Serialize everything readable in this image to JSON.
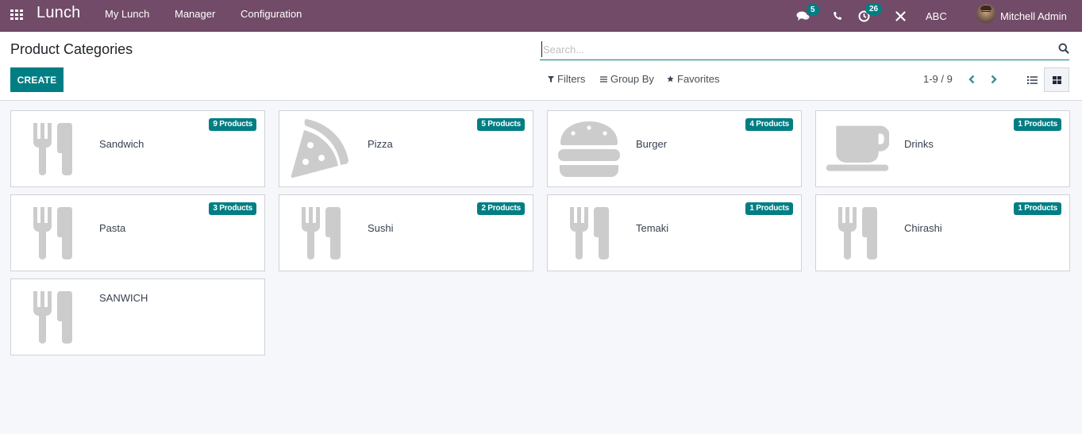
{
  "navbar": {
    "app_name": "Lunch",
    "menus": [
      "My Lunch",
      "Manager",
      "Configuration"
    ],
    "messages_count": "5",
    "activities_count": "26",
    "company": "ABC",
    "user_name": "Mitchell Admin",
    "bg_color": "#714b67",
    "badge_color": "#017e84"
  },
  "control_panel": {
    "title": "Product Categories",
    "create_label": "CREATE",
    "search_placeholder": "Search...",
    "search_value": "",
    "filters_label": "Filters",
    "group_by_label": "Group By",
    "favorites_label": "Favorites",
    "pager": "1-9 / 9",
    "active_view": "kanban"
  },
  "categories": [
    {
      "name": "Sandwich",
      "badge": "9 Products",
      "icon": "utensils-icon"
    },
    {
      "name": "Pizza",
      "badge": "5 Products",
      "icon": "pizza-icon"
    },
    {
      "name": "Burger",
      "badge": "4 Products",
      "icon": "burger-icon"
    },
    {
      "name": "Drinks",
      "badge": "1 Products",
      "icon": "coffee-cup-icon"
    },
    {
      "name": "Pasta",
      "badge": "3 Products",
      "icon": "utensils-icon"
    },
    {
      "name": "Sushi",
      "badge": "2 Products",
      "icon": "utensils-icon"
    },
    {
      "name": "Temaki",
      "badge": "1 Products",
      "icon": "utensils-icon"
    },
    {
      "name": "Chirashi",
      "badge": "1 Products",
      "icon": "utensils-icon"
    },
    {
      "name": "SANWICH",
      "badge": null,
      "icon": "utensils-icon"
    }
  ]
}
